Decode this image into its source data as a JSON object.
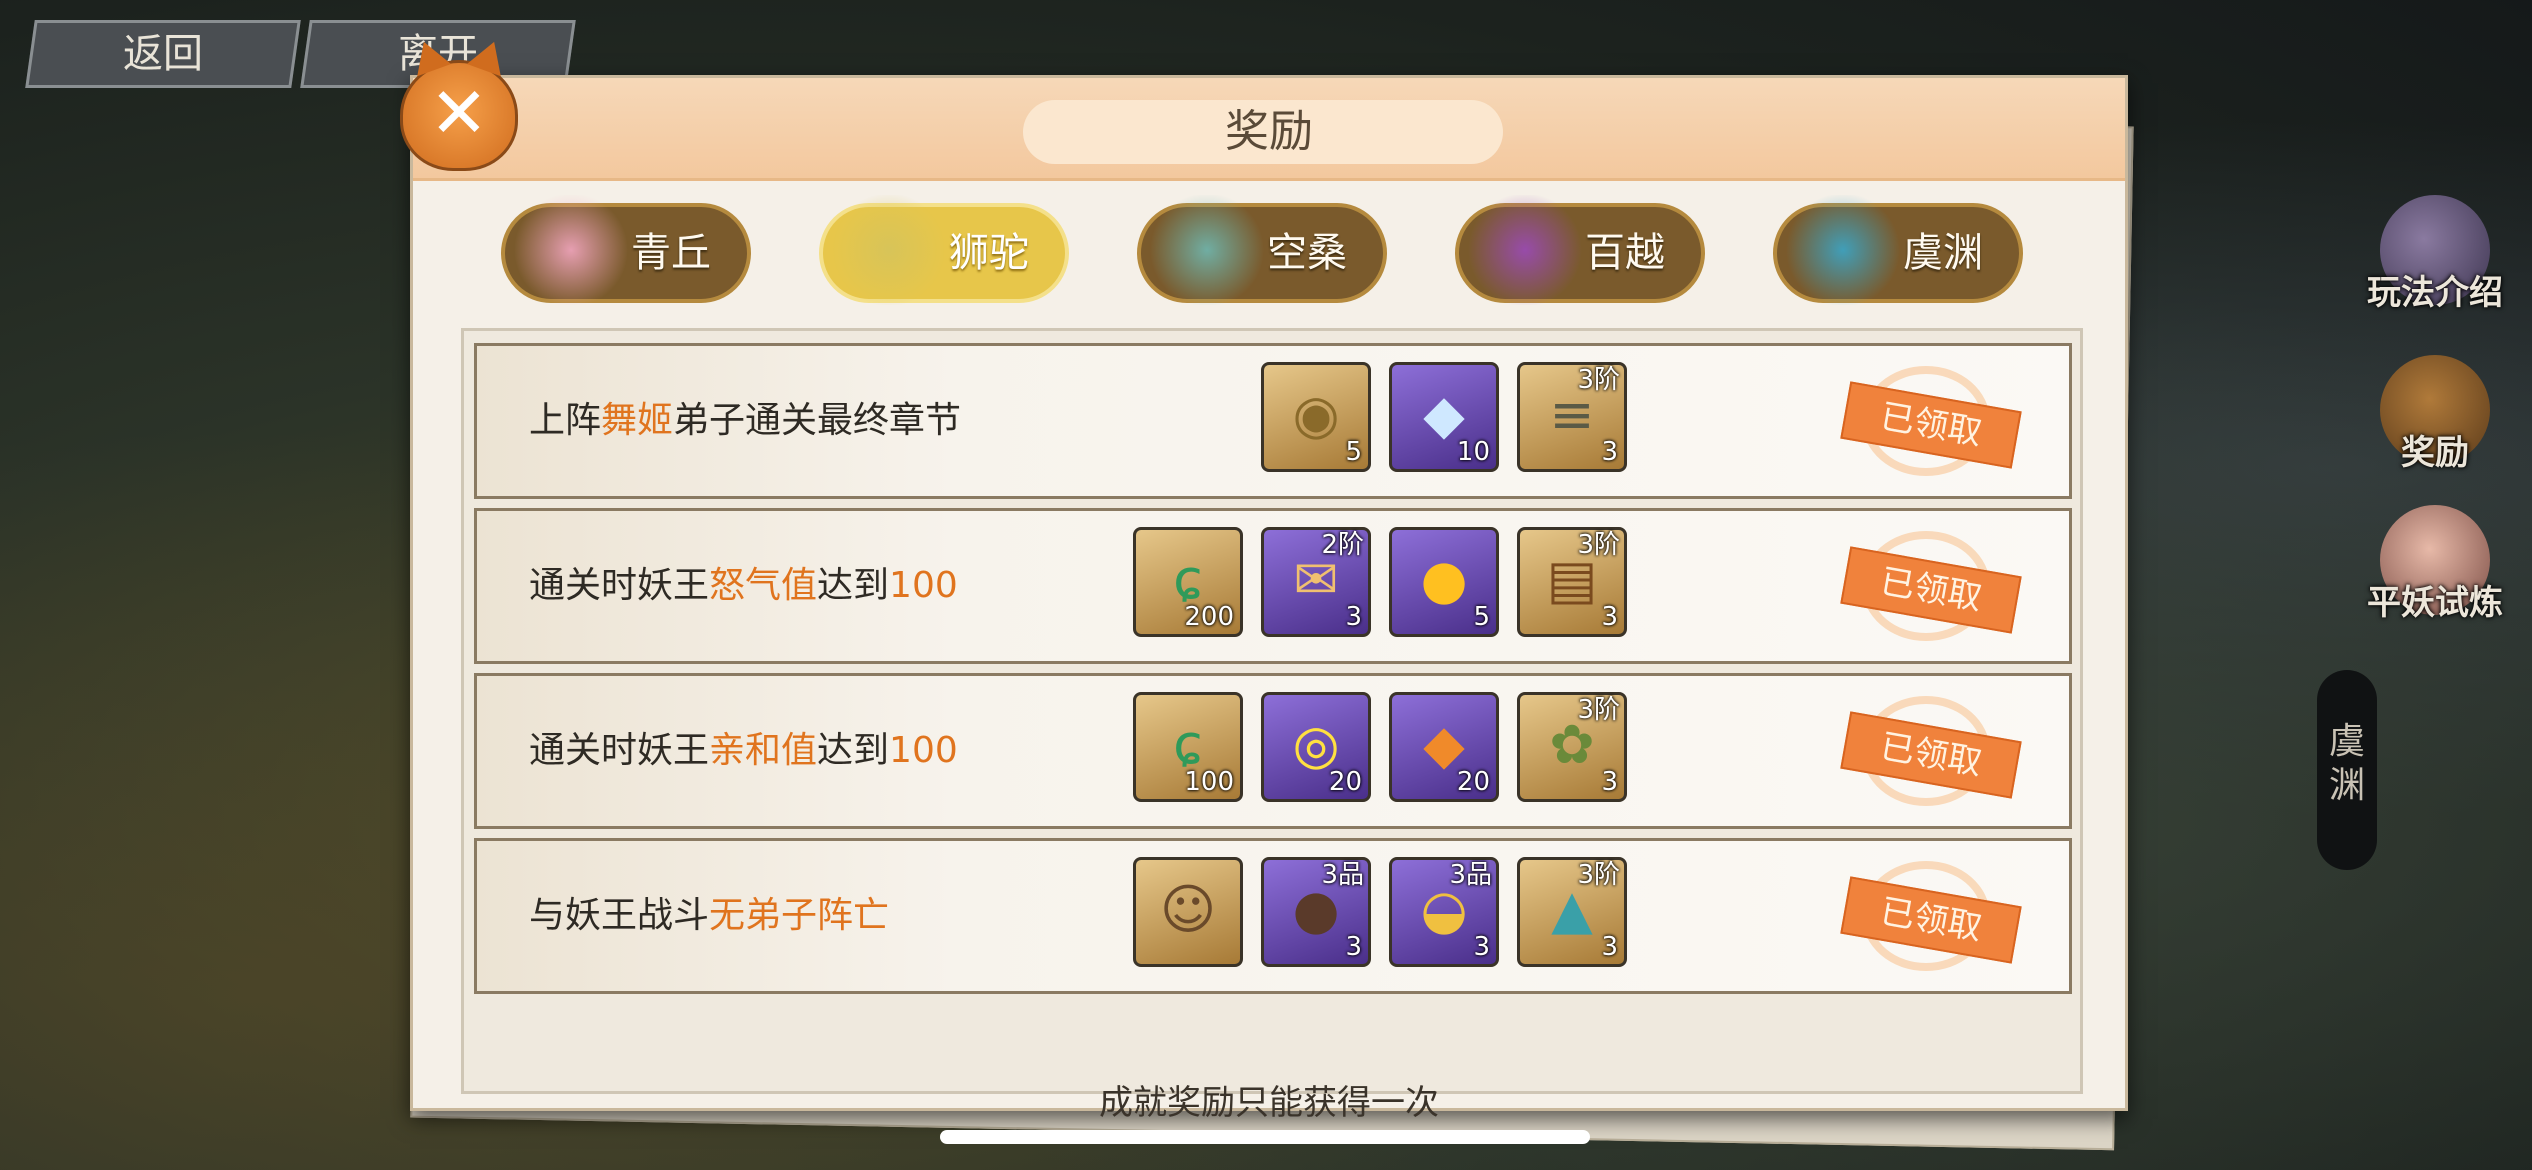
{
  "nav": {
    "back_label": "返回",
    "leave_label": "离开"
  },
  "panel": {
    "title": "奖励",
    "footer_note": "成就奖励只能获得一次",
    "close_symbol": "✕"
  },
  "tabs": [
    {
      "label": "青丘",
      "active": false
    },
    {
      "label": "狮驼",
      "active": true
    },
    {
      "label": "空桑",
      "active": false
    },
    {
      "label": "百越",
      "active": false
    },
    {
      "label": "虞渊",
      "active": false
    }
  ],
  "side_menu": {
    "rules_label": "玩法介绍",
    "reward_label": "奖励",
    "trial_label": "平妖试炼",
    "region_label": "虞渊"
  },
  "tasks": [
    {
      "desc_pre": "上阵",
      "desc_hl": "舞姬",
      "desc_post": "弟子通关最终章节",
      "rewards": [
        {
          "icon": "coin-icon",
          "count": "5",
          "tier": ""
        },
        {
          "icon": "crystal-icon",
          "count": "10",
          "tier": ""
        },
        {
          "icon": "wood-logs-icon",
          "count": "3",
          "tier": "3阶"
        }
      ],
      "status": "已领取"
    },
    {
      "desc_pre": "通关时妖王",
      "desc_hl": "怒气值",
      "desc_post": "达到",
      "desc_num": "100",
      "rewards": [
        {
          "icon": "jade-icon",
          "count": "200",
          "tier": ""
        },
        {
          "icon": "scroll-pouch-icon",
          "count": "3",
          "tier": "2阶"
        },
        {
          "icon": "flame-drop-icon",
          "count": "5",
          "tier": ""
        },
        {
          "icon": "bundle-icon",
          "count": "3",
          "tier": "3阶"
        }
      ],
      "status": "已领取"
    },
    {
      "desc_pre": "通关时妖王",
      "desc_hl": "亲和值",
      "desc_post": "达到",
      "desc_num": "100",
      "rewards": [
        {
          "icon": "jade-icon",
          "count": "100",
          "tier": ""
        },
        {
          "icon": "golden-orb-icon",
          "count": "20",
          "tier": ""
        },
        {
          "icon": "amber-shard-icon",
          "count": "20",
          "tier": ""
        },
        {
          "icon": "herb-sack-icon",
          "count": "3",
          "tier": "3阶"
        }
      ],
      "status": "已领取"
    },
    {
      "desc_pre": "与妖王战斗",
      "desc_hl": "无弟子阵亡",
      "desc_post": "",
      "rewards": [
        {
          "icon": "hero-portrait-icon",
          "count": "",
          "tier": ""
        },
        {
          "icon": "seed-pod-icon",
          "count": "3",
          "tier": "3品"
        },
        {
          "icon": "golden-bowl-icon",
          "count": "3",
          "tier": "3品"
        },
        {
          "icon": "ore-sack-icon",
          "count": "3",
          "tier": "3阶"
        }
      ],
      "status": "已领取"
    }
  ],
  "colors": {
    "highlight": "#e0741e",
    "active_tab": "#e7c64a",
    "stamp": "#f0823c"
  }
}
